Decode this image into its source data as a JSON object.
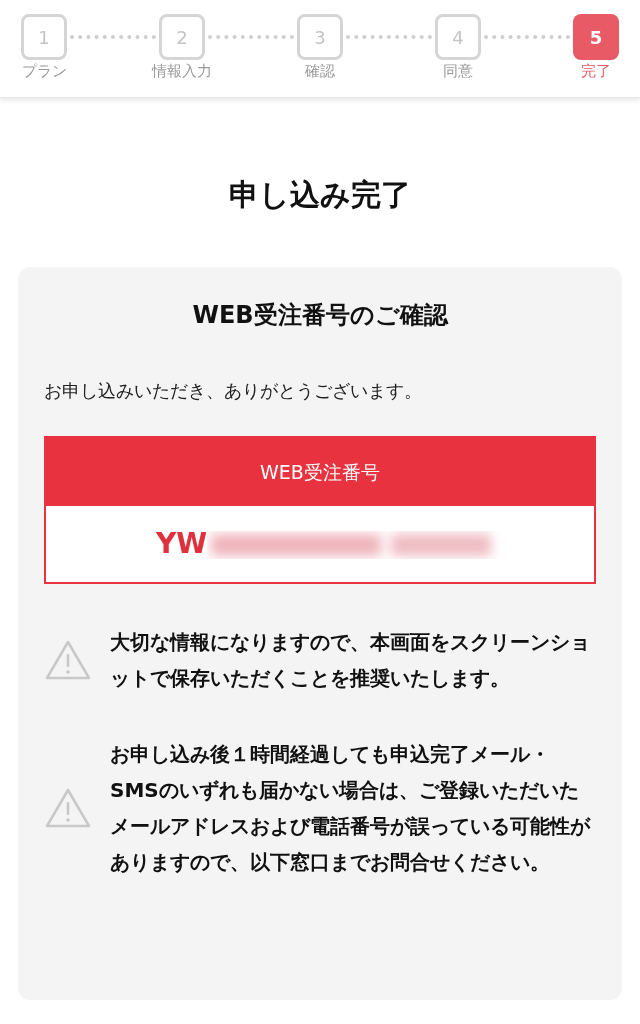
{
  "steps": [
    {
      "number": "1",
      "label": "プラン",
      "selected": false
    },
    {
      "number": "2",
      "label": "情報入力",
      "selected": false
    },
    {
      "number": "3",
      "label": "確認",
      "selected": false
    },
    {
      "number": "4",
      "label": "同意",
      "selected": false
    },
    {
      "number": "5",
      "label": "完了",
      "selected": true
    }
  ],
  "title": "申し込み完了",
  "card": {
    "heading": "WEB受注番号のご確認",
    "message": "お申し込みいただき、ありがとうございます。",
    "order": {
      "label": "WEB受注番号",
      "value": "YW"
    },
    "notices": [
      {
        "text": "大切な情報になりますので、本画面をスクリーンショットで保存いただくことを推奨いたします。"
      },
      {
        "text": "お申し込み後１時間経過しても申込完了メール・SMSのいずれも届かない場合は、ご登録いただいたメールアドレスおよび電話番号が誤っている可能性がありますので、以下窓口までお問合せください。"
      }
    ]
  }
}
